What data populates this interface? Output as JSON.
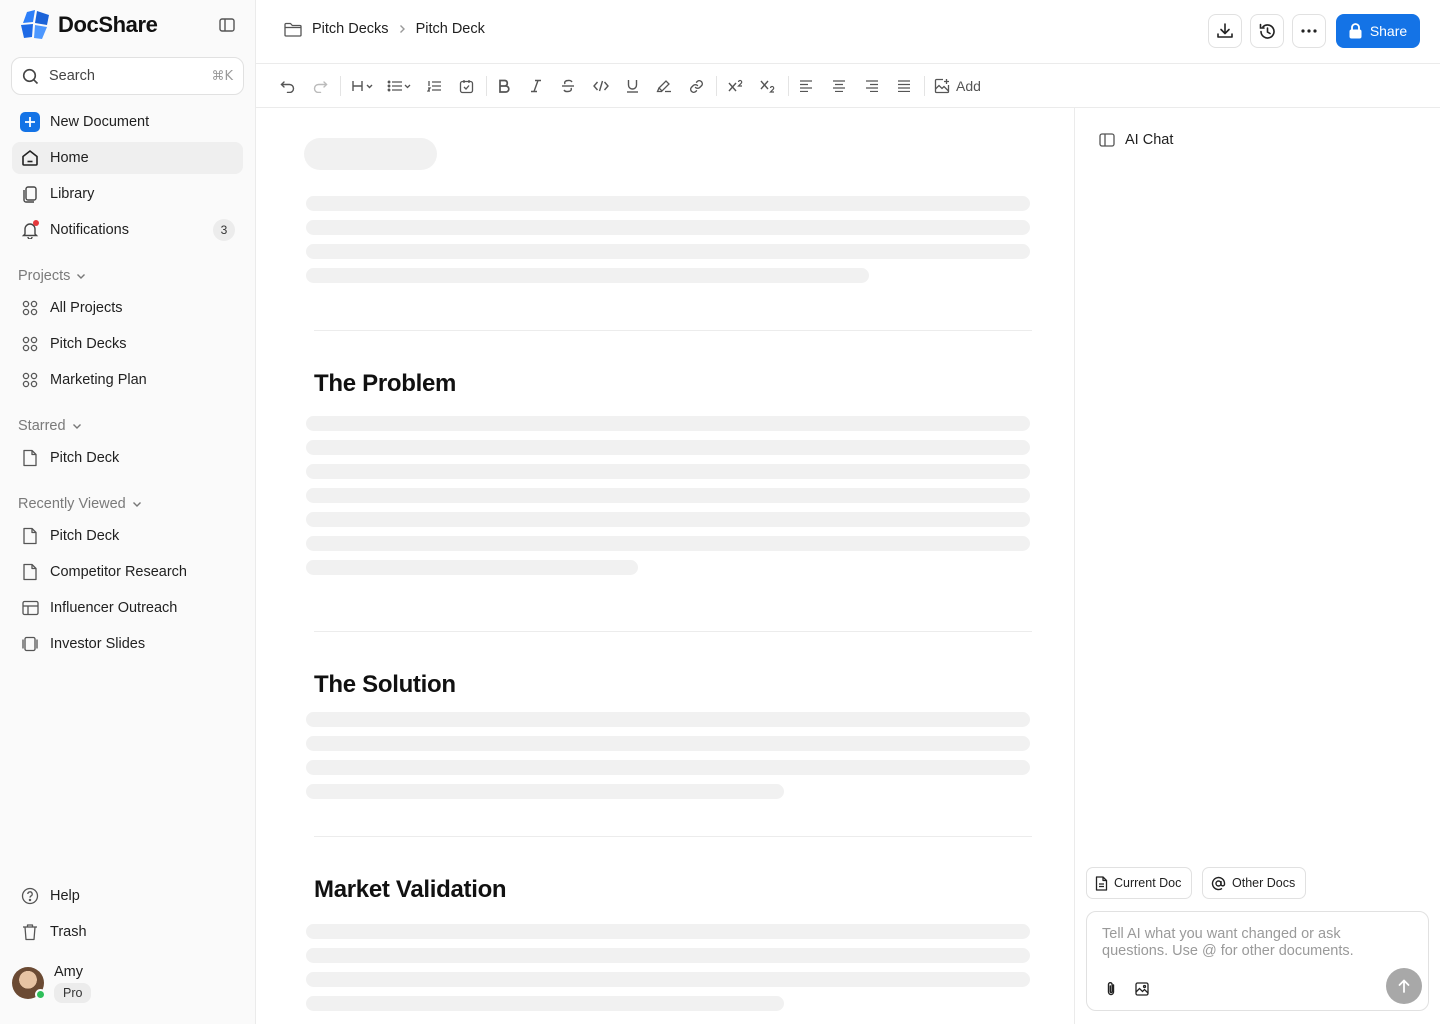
{
  "app": {
    "name": "DocShare",
    "accent": "#1473e6"
  },
  "sidebar": {
    "search": {
      "label": "Search",
      "shortcut": "⌘K"
    },
    "nav": [
      {
        "label": "New Document",
        "icon": "plus-icon"
      },
      {
        "label": "Home",
        "icon": "home-icon",
        "active": true
      },
      {
        "label": "Library",
        "icon": "library-icon"
      },
      {
        "label": "Notifications",
        "icon": "bell-icon",
        "badge": "3"
      }
    ],
    "projects": {
      "title": "Projects",
      "items": [
        "All Projects",
        "Pitch Decks",
        "Marketing Plan"
      ]
    },
    "starred": {
      "title": "Starred",
      "items": [
        "Pitch Deck"
      ]
    },
    "recent": {
      "title": "Recently Viewed",
      "items": [
        {
          "label": "Pitch Deck",
          "icon": "document-icon"
        },
        {
          "label": "Competitor Research",
          "icon": "document-icon"
        },
        {
          "label": "Influencer Outreach",
          "icon": "table-icon"
        },
        {
          "label": "Investor Slides",
          "icon": "slides-icon"
        }
      ]
    },
    "footer": {
      "help": "Help",
      "trash": "Trash"
    },
    "user": {
      "name": "Amy",
      "plan": "Pro",
      "status_color": "#2fbf5a"
    }
  },
  "topbar": {
    "breadcrumb": [
      "Pitch Decks",
      "Pitch Deck"
    ],
    "share_label": "Share"
  },
  "toolbar": {
    "add_label": "Add"
  },
  "document": {
    "sections": [
      "The Problem",
      "The Solution",
      "Market Validation"
    ]
  },
  "ai_chat": {
    "title": "AI Chat",
    "chips": [
      "Current Doc",
      "Other Docs"
    ],
    "placeholder": "Tell AI what you want changed or ask questions. Use @ for other documents."
  }
}
